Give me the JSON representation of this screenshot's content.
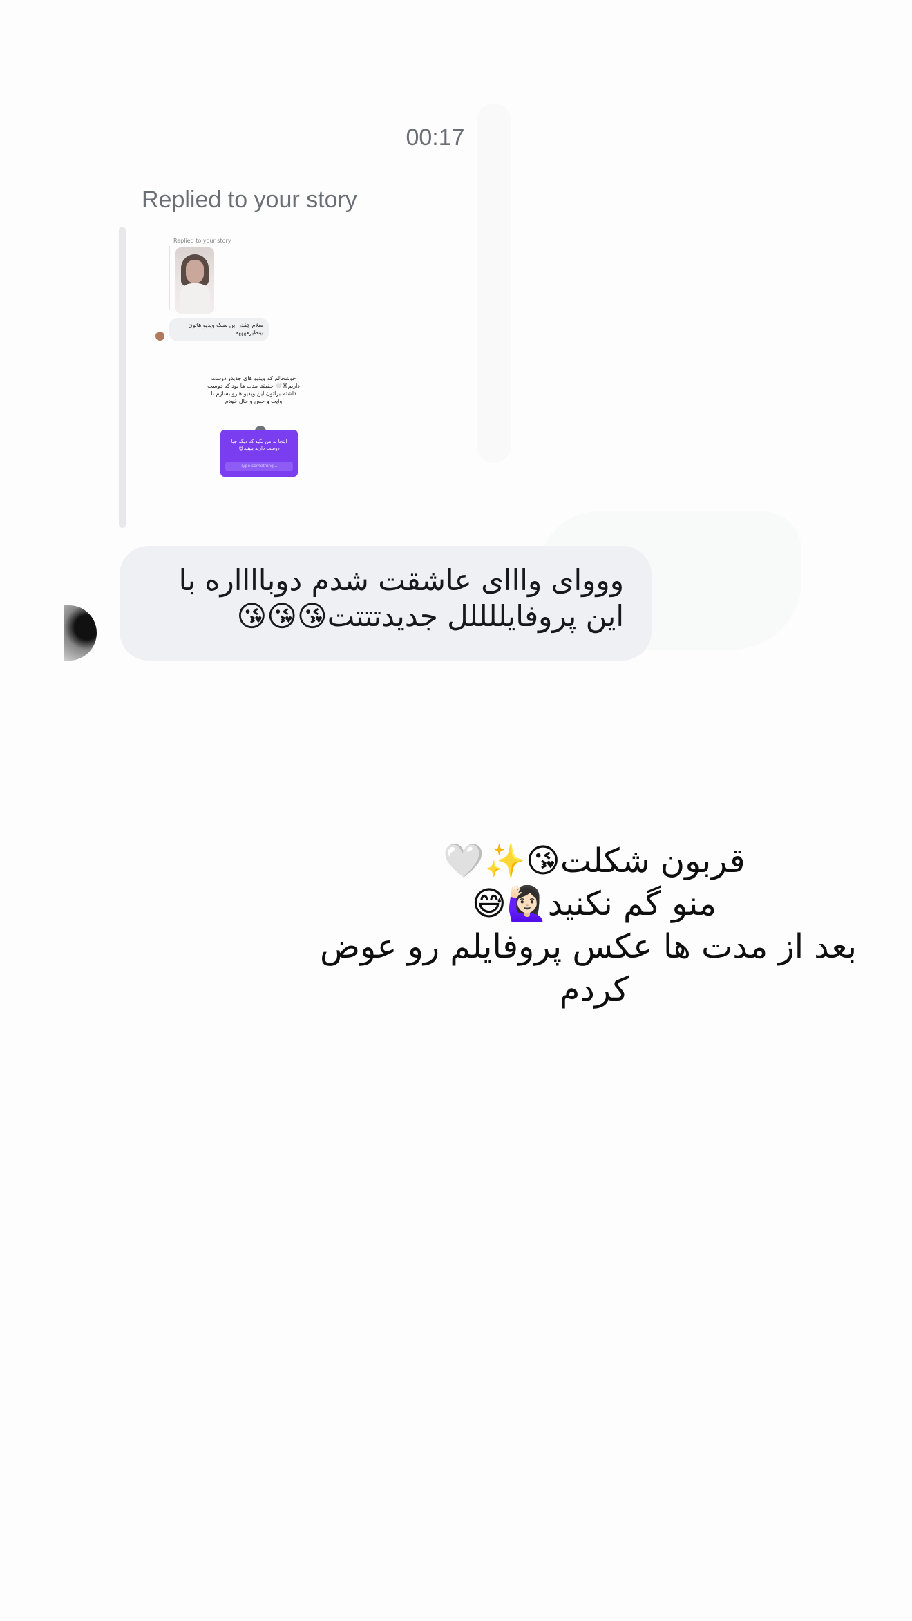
{
  "chat": {
    "timestamp": "00:17",
    "reply_context_label": "Replied to your story",
    "message_text": "ووواى واااى عاشقت شدم دوبااااره با اين پروفايللللل جديدتتتت😘😘😘"
  },
  "story_preview": {
    "label": "Replied to your story",
    "reply_bubble_text": "سلام چقدر این سبک ویدیو هاتون بینظیرههههه",
    "caption_text": "خوشحالم که ویدیو های جدیدو دوست داریم😍🤍 حقیقتا مدت ها بود که دوست داشتم براتون این ویدیو هارو بسازم با وایب و حس و حال خودم",
    "question_text": "اینجا به من بگید که دیگه چیا دوست دارید ببینید😅",
    "question_placeholder": "Type something..."
  },
  "story": {
    "lines": [
      "قربون شكلت😘✨🤍",
      "منو گم نكنيد🙋🏻‍♀️😅",
      "بعد از مدت ها عكس پروفايلم رو عوض",
      "كردم"
    ]
  }
}
